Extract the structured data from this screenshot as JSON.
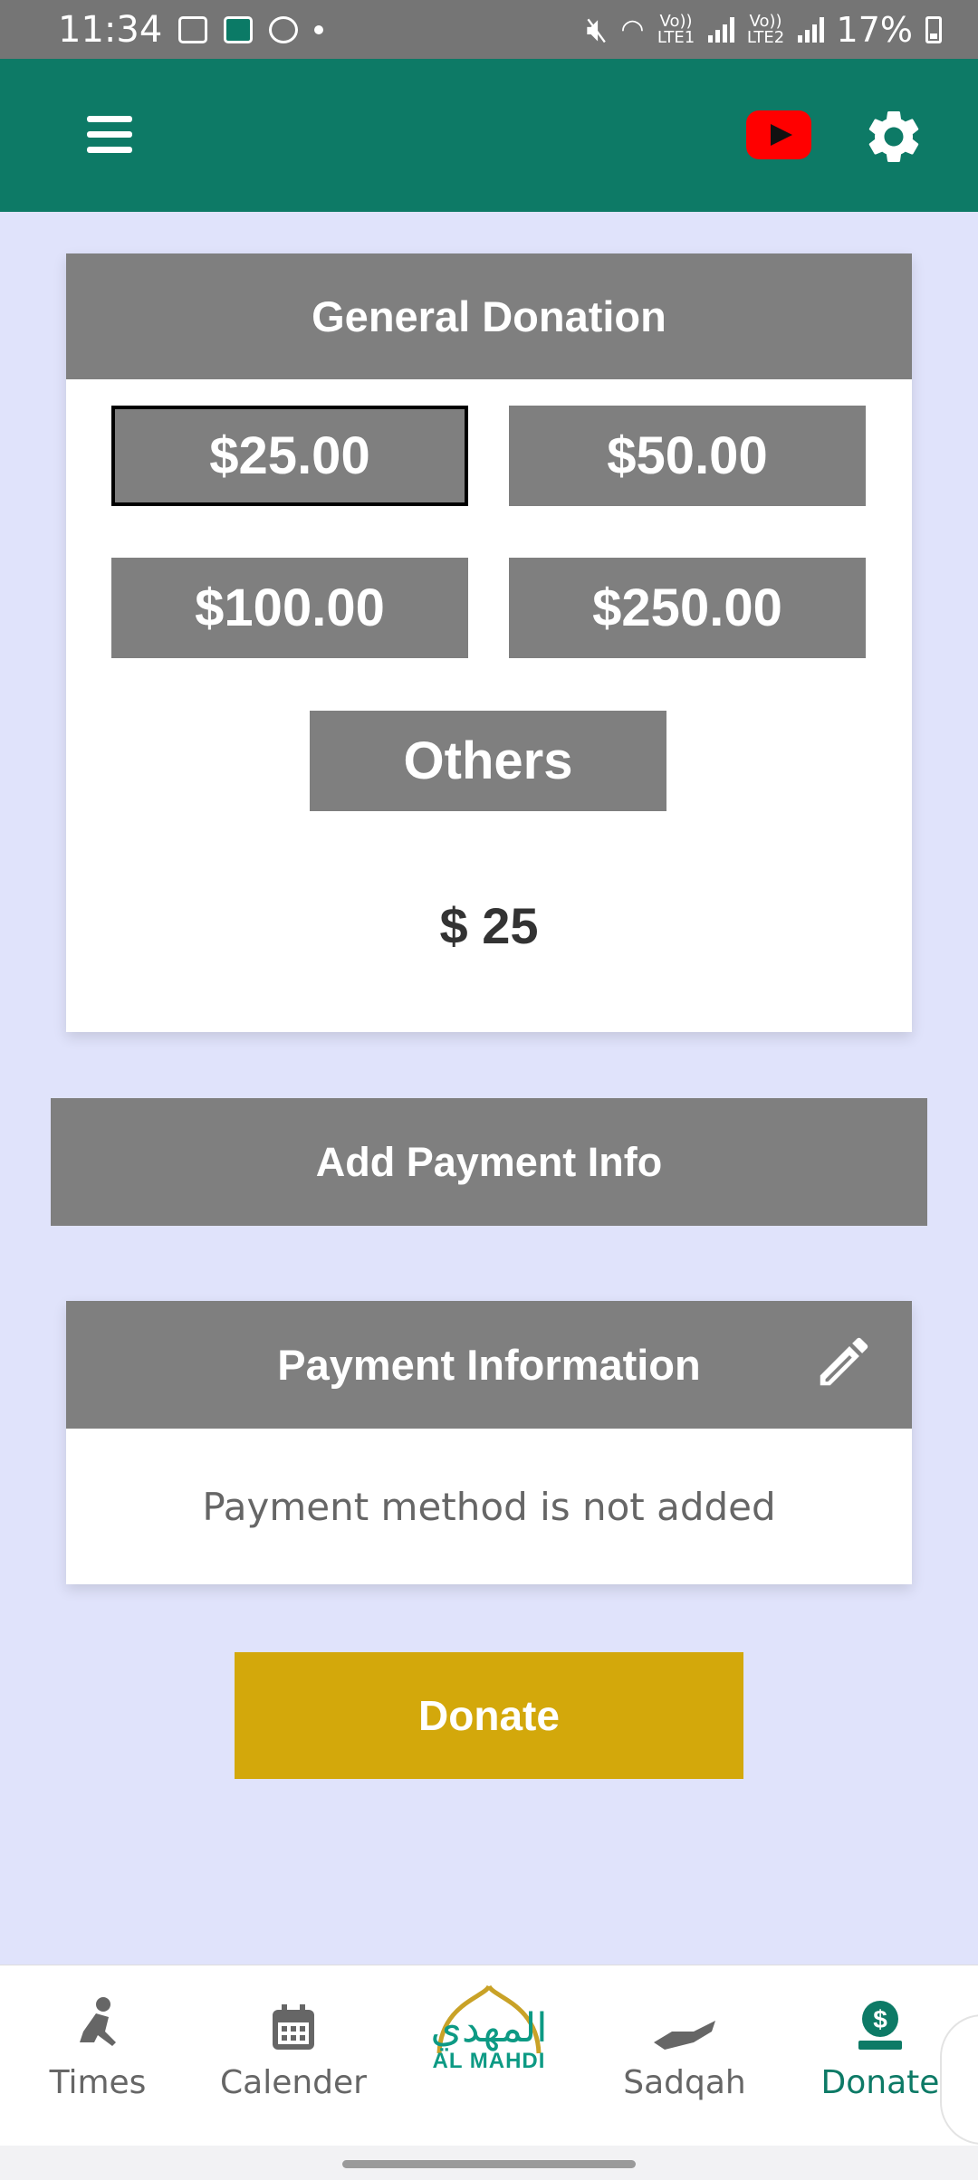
{
  "status_bar": {
    "time": "11:34",
    "network1": "Vo)) LTE1",
    "network2": "Vo)) LTE2",
    "battery": "17%"
  },
  "app_bar": {
    "menu_icon": "hamburger-icon",
    "youtube_icon": "youtube-icon",
    "settings_icon": "gear-icon"
  },
  "donation": {
    "title": "General Donation",
    "amounts": [
      "$25.00",
      "$50.00",
      "$100.00",
      "$250.00"
    ],
    "selected_amount": "$25.00",
    "others_label": "Others",
    "current_amount": "$ 25"
  },
  "add_payment_label": "Add Payment Info",
  "payment": {
    "title": "Payment Information",
    "edit_icon": "pencil-icon",
    "status_text": "Payment method is not added"
  },
  "donate_label": "Donate",
  "bottom_nav": {
    "items": [
      {
        "label": "Times",
        "icon": "prayer-icon"
      },
      {
        "label": "Calender",
        "icon": "calendar-icon"
      },
      {
        "label": "Sadqah",
        "icon": "hand-icon"
      },
      {
        "label": "Donate",
        "icon": "dollar-donate-icon"
      }
    ],
    "logo_text_en": "AL MAHDI",
    "logo_text_ar": "المهدي",
    "active": "Donate"
  },
  "colors": {
    "primary": "#0d7a66",
    "accent": "#d3a80b",
    "background": "#e0e3fb",
    "button_gray": "#7f7f7f"
  }
}
